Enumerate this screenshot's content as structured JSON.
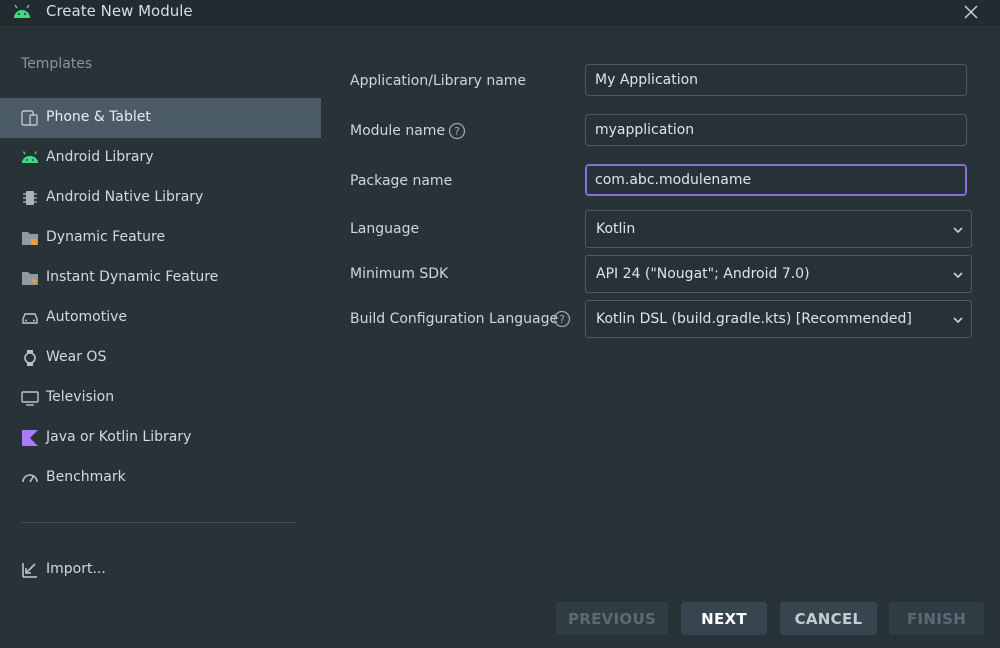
{
  "window": {
    "title": "Create New Module"
  },
  "sidebar": {
    "heading": "Templates",
    "items": [
      {
        "label": "Phone & Tablet",
        "icon": "phone-tablet-icon",
        "selected": true
      },
      {
        "label": "Android Library",
        "icon": "android-icon"
      },
      {
        "label": "Android Native Library",
        "icon": "chip-icon"
      },
      {
        "label": "Dynamic Feature",
        "icon": "folder-icon"
      },
      {
        "label": "Instant Dynamic Feature",
        "icon": "folder-lightning-icon"
      },
      {
        "label": "Automotive",
        "icon": "car-icon"
      },
      {
        "label": "Wear OS",
        "icon": "watch-icon"
      },
      {
        "label": "Television",
        "icon": "tv-icon"
      },
      {
        "label": "Java or Kotlin Library",
        "icon": "kotlin-icon"
      },
      {
        "label": "Benchmark",
        "icon": "gauge-icon"
      }
    ],
    "import_label": "Import..."
  },
  "form": {
    "app_name": {
      "label": "Application/Library name",
      "value": "My Application"
    },
    "module_name": {
      "label": "Module name",
      "value": "myapplication"
    },
    "package_name": {
      "label": "Package name",
      "value": "com.abc.modulename"
    },
    "language": {
      "label": "Language",
      "value": "Kotlin"
    },
    "min_sdk": {
      "label": "Minimum SDK",
      "value": "API 24 (\"Nougat\"; Android 7.0)"
    },
    "build_config": {
      "label": "Build Configuration Language",
      "value": "Kotlin DSL (build.gradle.kts) [Recommended]"
    }
  },
  "buttons": {
    "previous": "PREVIOUS",
    "next": "NEXT",
    "cancel": "CANCEL",
    "finish": "FINISH"
  },
  "colors": {
    "background": "#283338",
    "selected": "#4b5c67",
    "focus": "#8c6dd7",
    "android_green": "#3ddc84",
    "kotlin_purple": "#a97bff"
  }
}
